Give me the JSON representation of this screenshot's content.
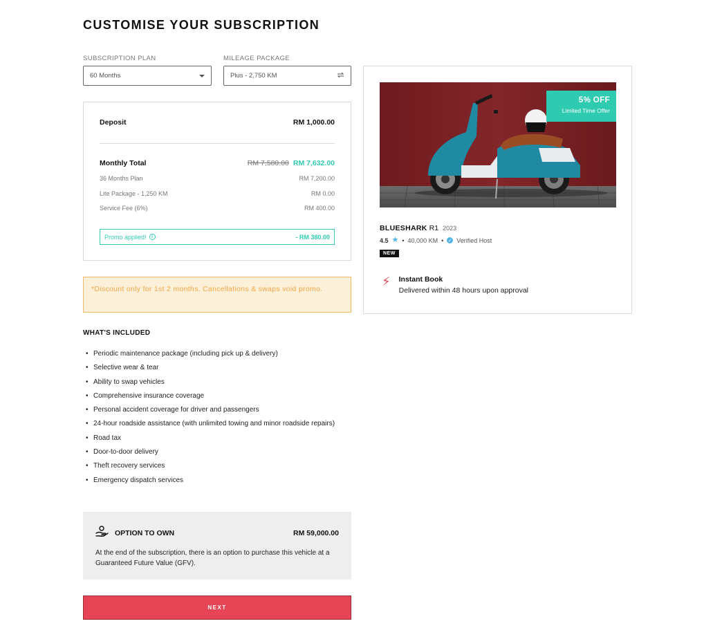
{
  "page": {
    "title": "CUSTOMISE YOUR SUBSCRIPTION"
  },
  "plan": {
    "label": "SUBSCRIPTION PLAN",
    "value": "60 Months"
  },
  "mileage": {
    "label": "MILEAGE PACKAGE",
    "value": "Plus - 2,750 KM"
  },
  "summary": {
    "deposit_label": "Deposit",
    "deposit_value": "RM 1,000.00",
    "monthly_label": "Monthly Total",
    "monthly_old": "RM 7,580.00",
    "monthly_new": "RM 7,632.00",
    "lines": [
      {
        "label": "36 Months Plan",
        "value": "RM 7,200.00"
      },
      {
        "label": "Lite Package - 1,250 KM",
        "value": "RM 0.00"
      },
      {
        "label": "Service Fee (6%)",
        "value": "RM 400.00"
      }
    ],
    "promo_label": "Promo applied!",
    "promo_info_glyph": "i",
    "promo_value": "- RM 380.00"
  },
  "notice": {
    "text": "*Discount only for 1st 2 months. Cancellations & swaps void promo."
  },
  "included": {
    "title": "WHAT'S INCLUDED",
    "items": [
      "Periodic maintenance package (including pick up & delivery)",
      "Selective wear & tear",
      "Ability to swap vehicles",
      "Comprehensive insurance coverage",
      "Personal accident coverage for driver and passengers",
      "24-hour roadside assistance (with unlimited towing and minor roadside repairs)",
      "Road tax",
      "Door-to-door delivery",
      "Theft recovery services",
      "Emergency dispatch services"
    ]
  },
  "own": {
    "title": "OPTION TO OWN",
    "price": "RM 59,000.00",
    "description": "At the end of the subscription, there is an option to purchase this vehicle at a Guaranteed Future Value (GFV)."
  },
  "next_label": "NEXT",
  "vehicle": {
    "offer_main": "5% OFF",
    "offer_sub": "Limited Time Offer",
    "brand": "BLUESHARK",
    "model": "R1",
    "year": "2023",
    "rating": "4.5",
    "star_glyph": "★",
    "dot_glyph": "•",
    "mileage": "40,000 KM",
    "verified_glyph": "✓",
    "verified_label": "Verified Host",
    "new_badge": "NEW",
    "bolt_glyph": "⚡",
    "instant_title": "Instant Book",
    "instant_sub": "Delivered within 48 hours upon approval"
  },
  "icons": {
    "plan_caret": "chevron-down-icon",
    "mileage_swap": "swap-icon",
    "promo_info": "info-icon",
    "star": "star-icon",
    "verified": "verified-icon",
    "instant": "lightning-icon",
    "own": "hand-coin-icon"
  },
  "colors": {
    "accent_teal": "#2fcbb0",
    "primary_red": "#e54555",
    "notice_bg": "#fdf0d8",
    "notice_text": "#f0a648",
    "star_blue": "#4fb3e8",
    "image_wall": "#7a1f22"
  }
}
